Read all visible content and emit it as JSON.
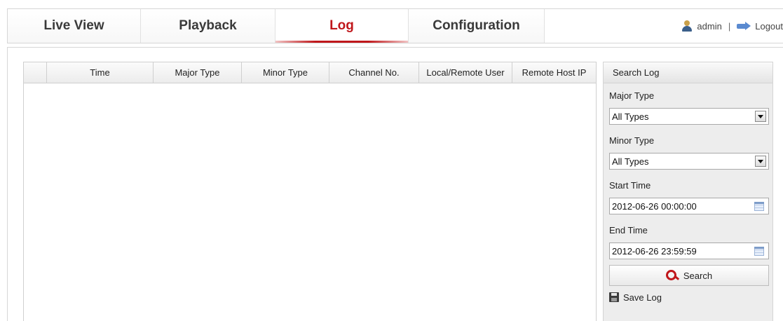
{
  "nav": {
    "tabs": [
      {
        "label": "Live View"
      },
      {
        "label": "Playback"
      },
      {
        "label": "Log"
      },
      {
        "label": "Configuration"
      }
    ],
    "active": "Log",
    "accent_color": "#c0171b",
    "user": "admin",
    "separator": "|",
    "logout": "Logout"
  },
  "log_table": {
    "columns": [
      "",
      "Time",
      "Major Type",
      "Minor Type",
      "Channel No.",
      "Local/Remote User",
      "Remote Host IP"
    ],
    "rows": []
  },
  "search_panel": {
    "title": "Search Log",
    "major_type_label": "Major Type",
    "major_type_value": "All Types",
    "minor_type_label": "Minor Type",
    "minor_type_value": "All Types",
    "start_time_label": "Start Time",
    "start_time_value": "2012-06-26 00:00:00",
    "end_time_label": "End Time",
    "end_time_value": "2012-06-26 23:59:59",
    "search_button": "Search",
    "save_log": "Save Log"
  }
}
